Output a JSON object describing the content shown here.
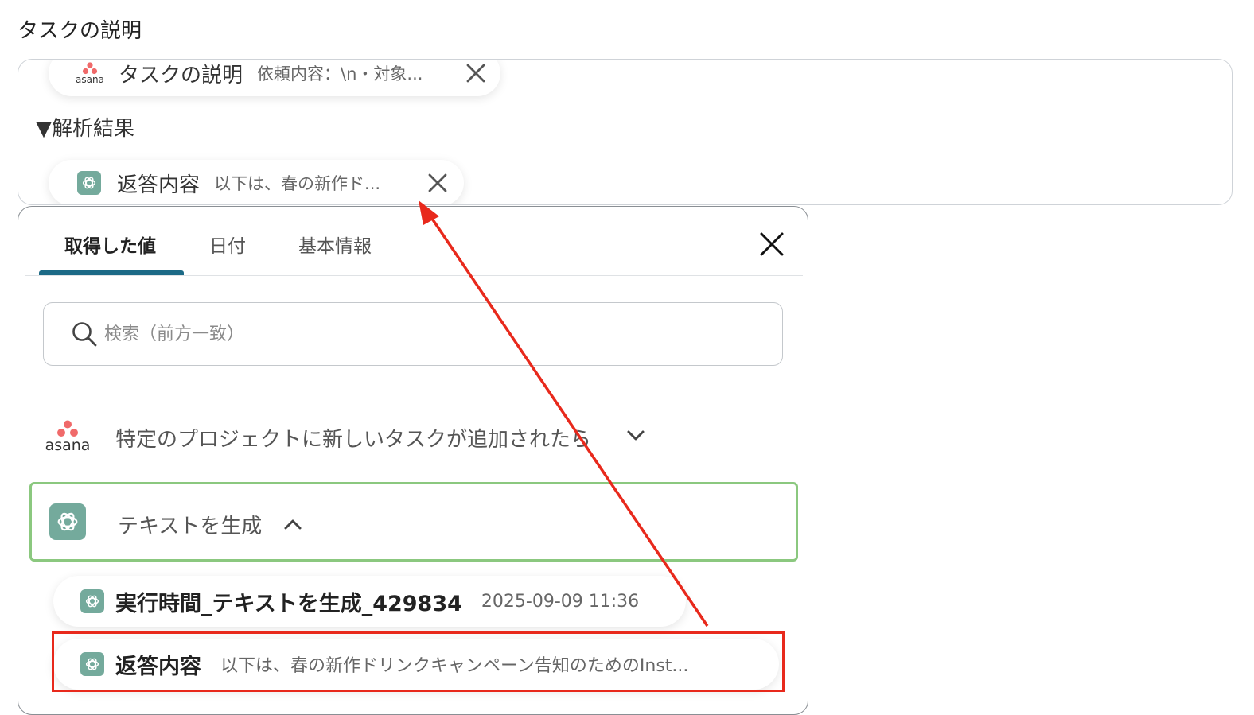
{
  "field": {
    "label": "タスクの説明",
    "chips": [
      {
        "app": "asana",
        "name": "タスクの説明",
        "preview": "依頼内容：\\n・対象..."
      },
      {
        "app": "openai",
        "name": "返答内容",
        "preview": "以下は、春の新作ド..."
      }
    ],
    "section_heading": "▼解析結果"
  },
  "picker": {
    "tabs": [
      {
        "label": "取得した値",
        "active": true
      },
      {
        "label": "日付",
        "active": false
      },
      {
        "label": "基本情報",
        "active": false
      }
    ],
    "search_placeholder": "検索（前方一致）",
    "groups": [
      {
        "app": "asana",
        "title": "特定のプロジェクトに新しいタスクが追加されたら",
        "expanded": false
      },
      {
        "app": "openai",
        "title": "テキストを生成",
        "expanded": true
      }
    ],
    "items": [
      {
        "name": "実行時間_テキストを生成_429834",
        "value": "2025-09-09 11:36"
      },
      {
        "name": "返答内容",
        "value": "以下は、春の新作ドリンクキャンペーン告知のためのInst...",
        "highlighted": true
      }
    ]
  },
  "icons": {
    "asana_logo_text": "asana",
    "asana_dot_color": "#f06a6a",
    "openai_bg_color": "#74aa9c",
    "accent_tab_color": "#1c6a86",
    "highlight_color": "#e8291c",
    "expanded_border_color": "#8bc87f"
  }
}
